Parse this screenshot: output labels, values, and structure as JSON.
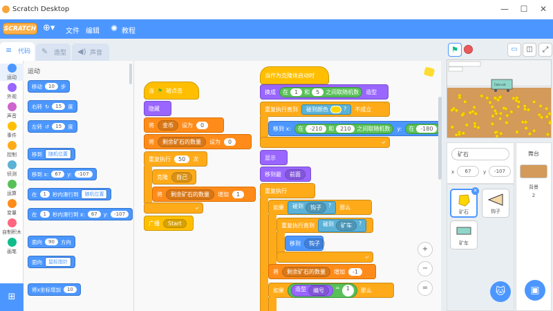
{
  "window": {
    "title": "Scratch Desktop"
  },
  "menu": {
    "brand": "SCRATCH",
    "file": "文件",
    "edit": "编辑",
    "tutorials": "教程"
  },
  "tabs": {
    "code": "代码",
    "costumes": "造型",
    "sounds": "声音"
  },
  "categories": [
    {
      "label": "运动",
      "color": "#4c97ff"
    },
    {
      "label": "外观",
      "color": "#9966ff"
    },
    {
      "label": "声音",
      "color": "#cf63cf"
    },
    {
      "label": "事件",
      "color": "#ffbf00"
    },
    {
      "label": "控制",
      "color": "#ffab19"
    },
    {
      "label": "侦测",
      "color": "#5cb1d6"
    },
    {
      "label": "运算",
      "color": "#59c059"
    },
    {
      "label": "变量",
      "color": "#ff8c1a"
    },
    {
      "label": "自制积木",
      "color": "#ff6680"
    },
    {
      "label": "画笔",
      "color": "#0fbd8c"
    }
  ],
  "palette": {
    "heading": "运动",
    "move": {
      "a": "移动",
      "v": "10",
      "b": "步"
    },
    "turn_right": {
      "a": "右转",
      "v": "15",
      "b": "度"
    },
    "turn_left": {
      "a": "左转",
      "v": "15",
      "b": "度"
    },
    "goto": {
      "a": "移到",
      "d": "随机位置"
    },
    "goto_xy": {
      "a": "移到 x:",
      "x": "67",
      "b": "y:",
      "y": "-107"
    },
    "glide": {
      "a": "在",
      "v": "1",
      "b": "秒内滑行到",
      "d": "随机位置"
    },
    "glide_xy": {
      "a": "在",
      "v": "1",
      "b": "秒内滑行到 x:",
      "x": "67",
      "c": "y:",
      "y": "-107"
    },
    "point": {
      "a": "面向",
      "v": "90",
      "b": "方向"
    },
    "point_towards": {
      "a": "面向",
      "d": "鼠标指针"
    },
    "change_x": {
      "a": "将x坐标增加",
      "v": "10"
    }
  },
  "script1": {
    "hat": "当",
    "hat2": "被点击",
    "hide": "隐藏",
    "set1": {
      "a": "将",
      "d": "金币",
      "b": "设为",
      "v": "0"
    },
    "set2": {
      "a": "将",
      "d": "剩余矿石的数量",
      "b": "设为",
      "v": "0"
    },
    "repeat": {
      "a": "重复执行",
      "v": "50",
      "b": "次"
    },
    "clone": {
      "a": "克隆",
      "d": "自己"
    },
    "change": {
      "a": "将",
      "d": "剩余矿石的数量",
      "b": "增加",
      "v": "1"
    },
    "broadcast": {
      "a": "广播",
      "d": "Start"
    }
  },
  "script2": {
    "hat": "当作为克隆体启动时",
    "costume": {
      "a": "换成",
      "b": "在",
      "v1": "1",
      "c": "和",
      "v2": "5",
      "d": "之间取随机数",
      "e": "造型"
    },
    "until": {
      "a": "重复执行直到",
      "b": "碰到颜色",
      "c": "?",
      "d": "不成立"
    },
    "goto": {
      "a": "移到 x:",
      "b": "在",
      "v1": "-210",
      "c": "和",
      "v2": "210",
      "d": "之间取随机数",
      "e": "y:",
      "f": "在",
      "v3": "-180"
    },
    "show": "显示",
    "front": {
      "a": "移到最",
      "d": "前面"
    },
    "forever": "重复执行",
    "if1": {
      "a": "如果",
      "b": "碰到",
      "d": "钩子",
      "c": "?",
      "e": "那么"
    },
    "until2": {
      "a": "重复执行直到",
      "b": "碰到",
      "d": "矿车",
      "c": "?"
    },
    "goto_hook": {
      "a": "移到",
      "d": "钩子"
    },
    "change": {
      "a": "将",
      "d": "剩余矿石的数量",
      "b": "增加",
      "v": "-1"
    },
    "if2": {
      "a": "如果",
      "b": "造型",
      "d": "编号",
      "c": "=",
      "v": "1",
      "e": "那么"
    }
  },
  "zoom": {
    "in": "+",
    "out": "−",
    "reset": "="
  },
  "sprite_info": {
    "name": "矿石",
    "x_label": "x",
    "x": "67",
    "y_label": "y",
    "y": "-107"
  },
  "sprites": [
    {
      "name": "矿石"
    },
    {
      "name": "钩子"
    },
    {
      "name": "矿车"
    }
  ],
  "stage_panel": {
    "title": "舞台",
    "backdrops_label": "背景",
    "backdrops_count": "2"
  },
  "stage": {
    "cart_label": "Cats-cat"
  },
  "colors": {
    "blue": "#4c97ff",
    "touch_color": "#ffd600"
  }
}
